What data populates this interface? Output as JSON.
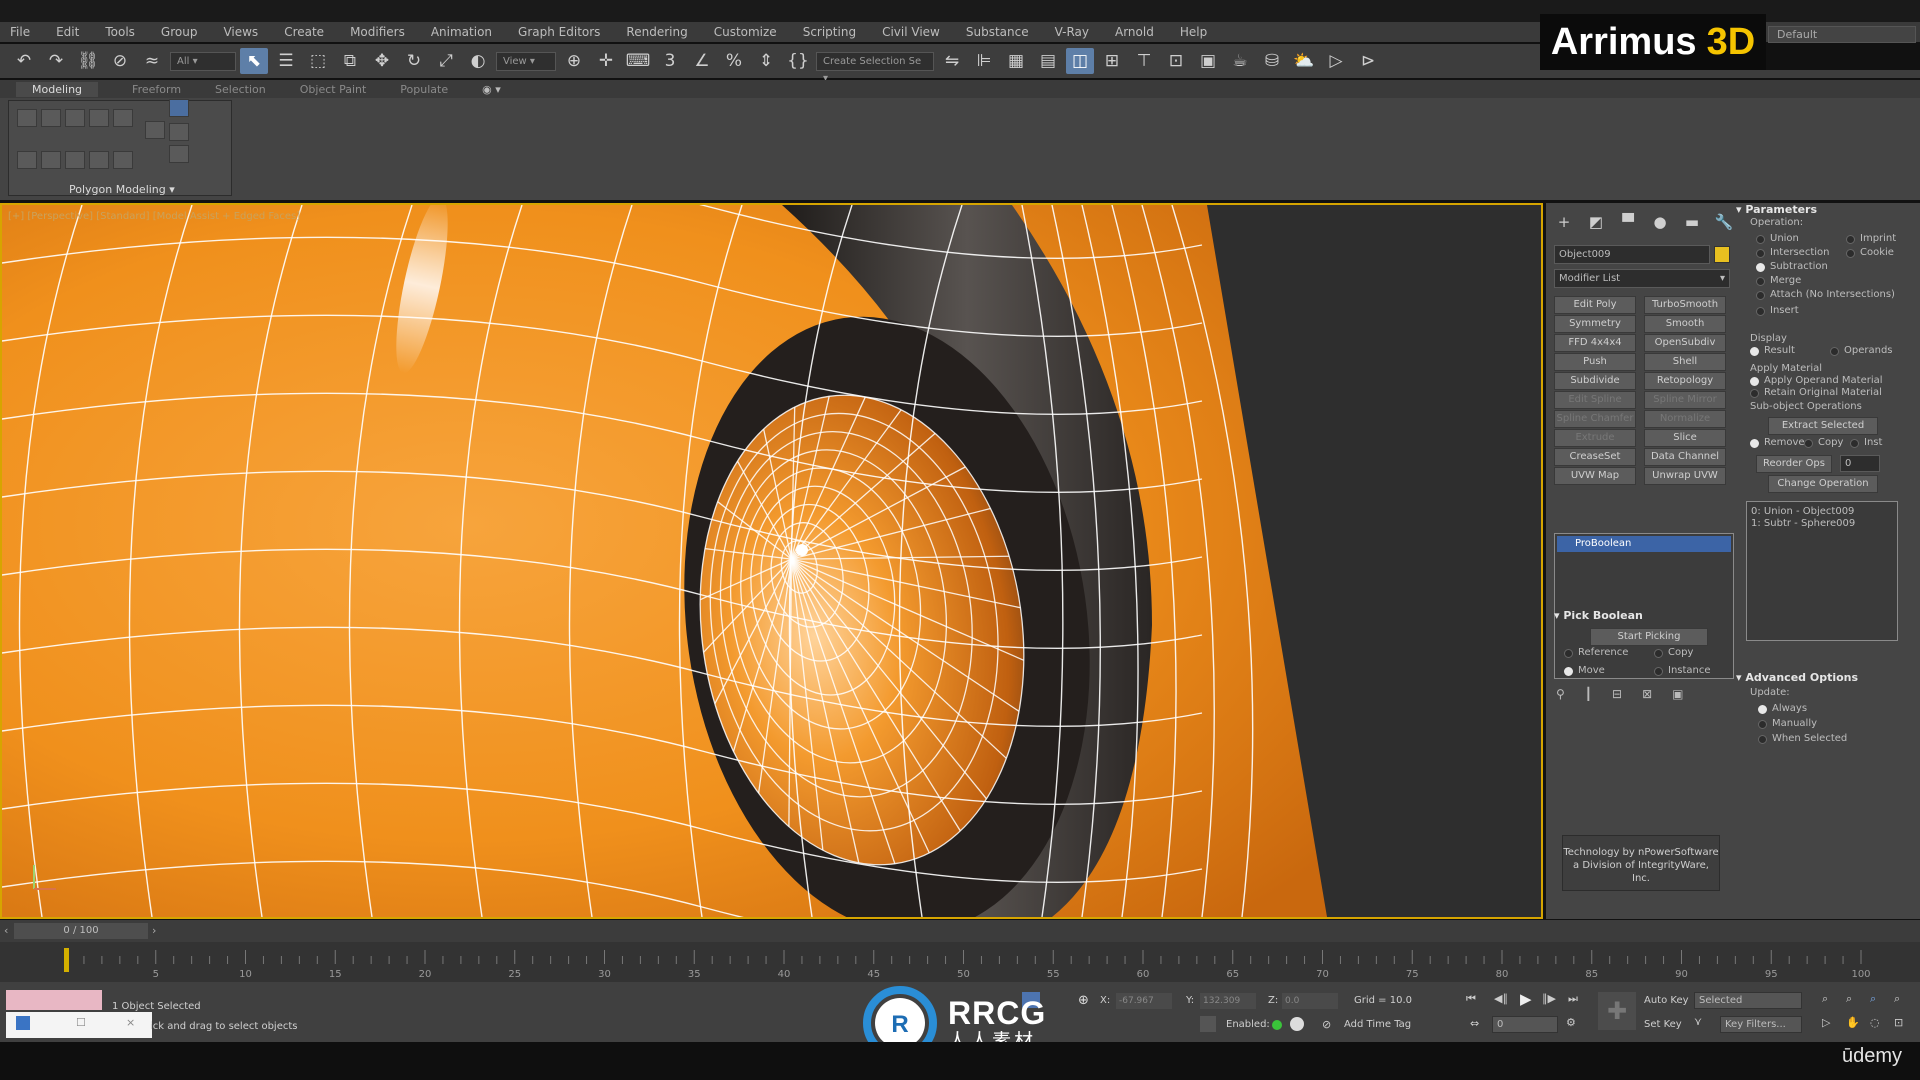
{
  "menu": [
    "File",
    "Edit",
    "Tools",
    "Group",
    "Views",
    "Create",
    "Modifiers",
    "Animation",
    "Graph Editors",
    "Rendering",
    "Customize",
    "Scripting",
    "Civil View",
    "Substance",
    "V-Ray",
    "Arnold",
    "Help"
  ],
  "brand": {
    "name": "Arrimus",
    "highlight": "3D"
  },
  "workspace": "Default",
  "toolbar": {
    "filter_dropdown": "All",
    "coord_dropdown": "View",
    "selection_set": "Create Selection Se"
  },
  "ribbon": {
    "tabs": [
      "Modeling",
      "Freeform",
      "Selection",
      "Object Paint",
      "Populate"
    ],
    "active_tab": "Modeling",
    "panel_label": "Polygon Modeling"
  },
  "viewport": {
    "label": "[+] [Perspective] [Standard] [Model Assist + Edged Faces]"
  },
  "command_panel": {
    "object_name": "Object009",
    "object_color": "#e8c020",
    "modifier_list": "Modifier List",
    "modifier_buttons": [
      [
        "Edit Poly",
        "TurboSmooth"
      ],
      [
        "Symmetry",
        "Smooth"
      ],
      [
        "FFD 4x4x4",
        "OpenSubdiv"
      ],
      [
        "Push",
        "Shell"
      ],
      [
        "Subdivide",
        "Retopology"
      ],
      [
        "Edit Spline",
        "Spline Mirror"
      ],
      [
        "Spline Chamfer",
        "Normalize Spline"
      ],
      [
        "Extrude",
        "Slice"
      ],
      [
        "CreaseSet",
        "Data Channel"
      ],
      [
        "UVW Map",
        "Unwrap UVW"
      ]
    ],
    "stack_item": "ProBoolean",
    "pick_boolean": {
      "title": "Pick Boolean",
      "start_button": "Start Picking",
      "options": [
        "Reference",
        "Copy",
        "Move",
        "Instance"
      ]
    },
    "tech_note": "Technology by nPowerSoftware a Division of IntegrityWare, Inc.",
    "parameters": {
      "title": "Parameters",
      "operation_label": "Operation:",
      "operations": [
        "Union",
        "Imprint",
        "Intersection",
        "Cookie",
        "Subtraction",
        "Merge",
        "Attach (No Intersections)",
        "Insert"
      ],
      "display_label": "Display",
      "display_options": [
        "Result",
        "Operands"
      ],
      "apply_material_label": "Apply Material",
      "apply_options": [
        "Apply Operand Material",
        "Retain Original Material"
      ],
      "subobject_label": "Sub-object Operations",
      "extract_button": "Extract Selected",
      "remove_options": [
        "Remove",
        "Copy",
        "Inst"
      ],
      "reorder_button": "Reorder Ops",
      "reorder_value": "0",
      "change_button": "Change Operation",
      "ops_list": [
        "0: Union - Object009",
        "1: Subtr - Sphere009"
      ]
    },
    "advanced": {
      "title": "Advanced Options",
      "update_label": "Update:",
      "options": [
        "Always",
        "Manually",
        "When Selected"
      ]
    }
  },
  "timeline": {
    "current": "0 / 100",
    "ticks": [
      "5",
      "10",
      "15",
      "20",
      "25",
      "30",
      "35",
      "40",
      "45",
      "50",
      "55",
      "60",
      "65",
      "70",
      "75",
      "80",
      "85",
      "90",
      "95",
      "100"
    ]
  },
  "status": {
    "selection": "1 Object Selected",
    "hint": "ick and drag to select objects",
    "x_label": "X:",
    "x_value": "-67.967",
    "y_label": "Y:",
    "y_value": "132.309",
    "z_label": "Z:",
    "z_value": "0.0",
    "grid": "Grid = 10.0",
    "enabled_label": "Enabled:",
    "add_time_tag": "Add Time Tag",
    "auto_key": "Auto Key",
    "selected": "Selected",
    "set_key": "Set Key",
    "key_filters": "Key Filters...",
    "frame_value": "0"
  },
  "watermark": {
    "latin": "RRCG",
    "cjk": "人人素材"
  },
  "udemy": "ūdemy"
}
